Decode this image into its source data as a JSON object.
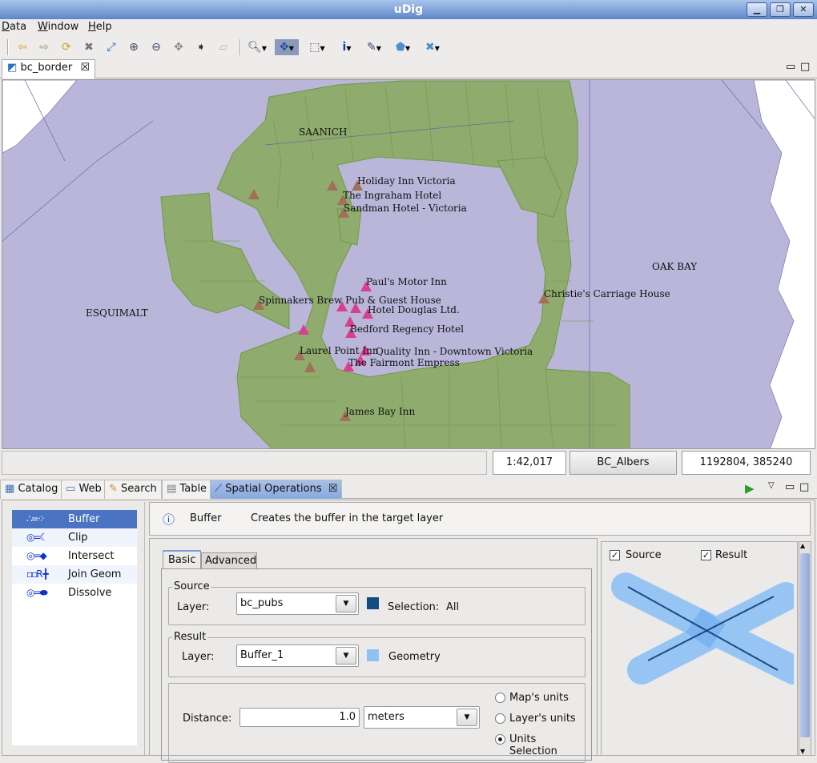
{
  "window": {
    "title": "uDig",
    "buttons": [
      "minimize",
      "maximize",
      "close"
    ]
  },
  "menu": [
    {
      "label": "Data",
      "key": "D",
      "rest": "ata"
    },
    {
      "label": "Window",
      "key": "W",
      "rest": "indow"
    },
    {
      "label": "Help",
      "key": "H",
      "rest": "elp"
    }
  ],
  "toolbar": [
    "back-icon",
    "forward-icon",
    "refresh-icon",
    "stop-icon",
    "zoom-extent-icon",
    "zoom-in-icon",
    "zoom-out-icon",
    "pan-icon",
    "next-icon",
    "eraser-icon",
    "zoom-tool-icon",
    "pan-tool-icon",
    "select-tool-icon",
    "info-tool-icon",
    "edit-tool-icon",
    "create-feature-icon",
    "delete-feature-icon"
  ],
  "editor_tab": {
    "label": "bc_border"
  },
  "map": {
    "colors": {
      "water": "#b9b6da",
      "land": "#8fab6d",
      "land_stroke": "#6f9a44",
      "white_land": "#ffffff",
      "hotel_brown": "#a0705a",
      "hotel_pink": "#d8408c"
    },
    "regions": [
      {
        "label": "SAANICH"
      },
      {
        "label": "OAK BAY"
      },
      {
        "label": "ESQUIMALT"
      }
    ],
    "hotels": [
      {
        "label": "Holiday Inn Victoria"
      },
      {
        "label": "The Ingraham Hotel"
      },
      {
        "label": "Sandman Hotel - Victoria"
      },
      {
        "label": "Paul's Motor Inn"
      },
      {
        "label": "Spinnakers Brew Pub & Guest House"
      },
      {
        "label": "Hotel Douglas Ltd."
      },
      {
        "label": "Christie's Carriage House"
      },
      {
        "label": "Bedford Regency Hotel"
      },
      {
        "label": "Laurel Point Inn"
      },
      {
        "label": "Quality Inn - Downtown Victoria"
      },
      {
        "label": "The Fairmont Empress"
      },
      {
        "label": "James Bay Inn"
      }
    ]
  },
  "status": {
    "scale": "1:42,017",
    "crs": "BC_Albers",
    "coords": "1192804, 385240"
  },
  "view_tabs": [
    {
      "label": "Catalog"
    },
    {
      "label": "Web"
    },
    {
      "label": "Search"
    },
    {
      "label": "Table"
    },
    {
      "label": "Spatial Operations"
    }
  ],
  "operations": [
    {
      "label": "Buffer",
      "icon": "∴=⁘"
    },
    {
      "label": "Clip",
      "icon": "◎=☾"
    },
    {
      "label": "Intersect",
      "icon": "◎=◆"
    },
    {
      "label": "Join Geom",
      "icon": "▫▫R ╋"
    },
    {
      "label": "Dissolve",
      "icon": "◎=⬬"
    }
  ],
  "info": {
    "title": "Buffer",
    "description": "Creates the buffer in the target layer"
  },
  "form": {
    "tabs": [
      "Basic",
      "Advanced"
    ],
    "source": {
      "group": "Source",
      "layer_label": "Layer:",
      "layer": "bc_pubs",
      "color": "#144a82",
      "selection_label": "Selection:",
      "selection": "All"
    },
    "result": {
      "group": "Result",
      "layer_label": "Layer:",
      "layer": "Buffer_1",
      "color": "#8ec2f5",
      "geometry": "Geometry"
    },
    "distance_label": "Distance:",
    "distance": "1.0",
    "units": "meters",
    "unit_options": [
      {
        "label": "Map's units",
        "checked": false
      },
      {
        "label": "Layer's units",
        "checked": false
      },
      {
        "label": "Units Selection",
        "checked": true
      }
    ]
  },
  "preview": {
    "source_label": "Source",
    "source_checked": true,
    "result_label": "Result",
    "result_checked": true,
    "check": "✓"
  }
}
